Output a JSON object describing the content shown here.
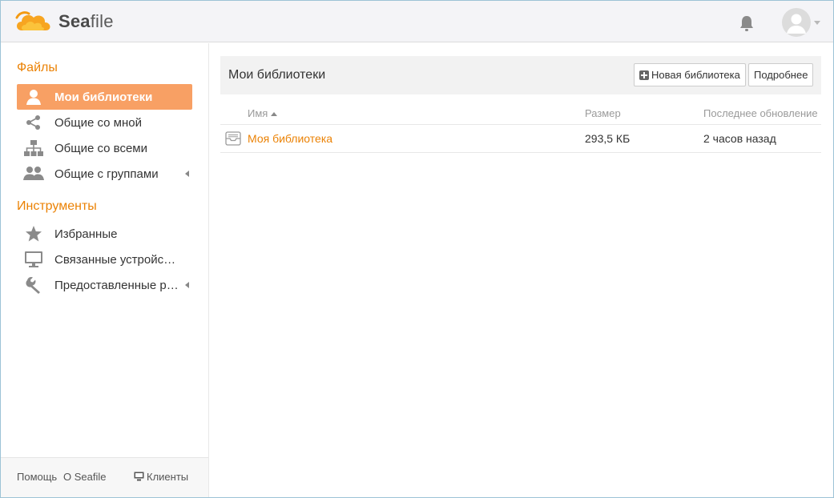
{
  "header": {
    "brand_prefix": "Sea",
    "brand_suffix": "file",
    "icons": {
      "logo": "seafile-cloud-logo",
      "notifications": "bell-icon",
      "user": "user-avatar-icon",
      "user_menu": "chevron-down-icon"
    }
  },
  "sidebar": {
    "files_heading": "Файлы",
    "files_items": [
      {
        "label": "Мои библиотеки",
        "icon": "user-icon",
        "active": true
      },
      {
        "label": "Общие со мной",
        "icon": "share-icon"
      },
      {
        "label": "Общие со всеми",
        "icon": "org-chart-icon"
      },
      {
        "label": "Общие с группами",
        "icon": "group-icon",
        "expandable": true
      }
    ],
    "tools_heading": "Инструменты",
    "tools_items": [
      {
        "label": "Избранные",
        "icon": "star-icon"
      },
      {
        "label": "Связанные устройства",
        "icon": "monitor-icon"
      },
      {
        "label": "Предоставленные ресурсы",
        "icon": "wrench-icon",
        "expandable": true
      }
    ],
    "footer": {
      "help": "Помощь",
      "about": "O Seafile",
      "clients": "Клиенты"
    }
  },
  "main": {
    "title": "Мои библиотеки",
    "new_library_button": "Новая библиотека",
    "details_button": "Подробнее",
    "table": {
      "columns": {
        "name": "Имя",
        "size": "Размер",
        "updated": "Последнее обновление"
      },
      "rows": [
        {
          "name": "Моя библиотека",
          "size": "293,5 КБ",
          "updated": "2 часов назад"
        }
      ]
    }
  },
  "colors": {
    "accent": "#eb8205",
    "active_item_bg": "#f8a064",
    "header_bg": "#f4f4f7",
    "icon_gray": "#8a8a8a"
  }
}
